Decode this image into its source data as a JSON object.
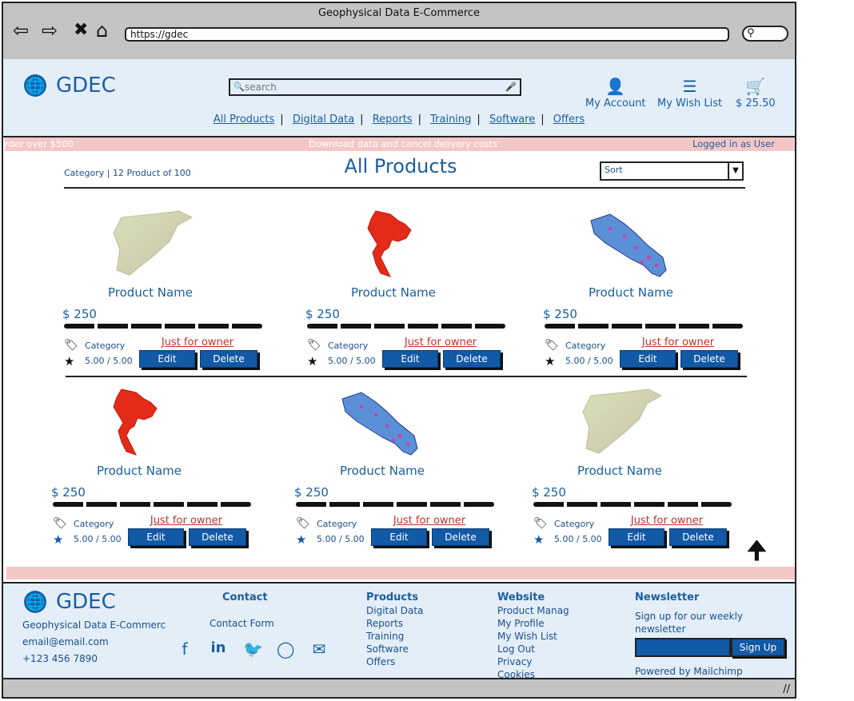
{
  "window": {
    "title": "Geophysical Data E-Commerce",
    "url": "https://gdec"
  },
  "header": {
    "logo": "GDEC",
    "search_placeholder": "search",
    "account": "My Account",
    "wishlist": "My Wish List",
    "cart_total": "$ 25.50",
    "menu": [
      "All Products",
      "Digital Data",
      "Reports",
      "Training",
      "Software",
      "Offers"
    ]
  },
  "promo": {
    "left": "rder over $500",
    "center": "Download data and cancel delivery costs",
    "login": "Logged in as User"
  },
  "listing": {
    "breadcrumb": "Category | 12 Product of 100",
    "title": "All Products",
    "sort": "Sort"
  },
  "products": [
    {
      "name": "Product Name",
      "price": "$ 250",
      "category": "Category",
      "rating": "5.00 / 5.00",
      "owner": "Just for owner",
      "edit": "Edit",
      "delete": "Delete",
      "map": "syria"
    },
    {
      "name": "Product Name",
      "price": "$ 250",
      "category": "Category",
      "rating": "5.00 / 5.00",
      "owner": "Just for owner",
      "edit": "Edit",
      "delete": "Delete",
      "map": "thailand"
    },
    {
      "name": "Product Name",
      "price": "$ 250",
      "category": "Category",
      "rating": "5.00 / 5.00",
      "owner": "Just for owner",
      "edit": "Edit",
      "delete": "Delete",
      "map": "costarica"
    },
    {
      "name": "Product Name",
      "price": "$ 250",
      "category": "Category",
      "rating": "5.00 / 5.00",
      "owner": "Just for owner",
      "edit": "Edit",
      "delete": "Delete",
      "map": "thailand"
    },
    {
      "name": "Product Name",
      "price": "$ 250",
      "category": "Category",
      "rating": "5.00 / 5.00",
      "owner": "Just for owner",
      "edit": "Edit",
      "delete": "Delete",
      "map": "costarica"
    },
    {
      "name": "Product Name",
      "price": "$ 250",
      "category": "Category",
      "rating": "5.00 / 5.00",
      "owner": "Just for owner",
      "edit": "Edit",
      "delete": "Delete",
      "map": "syria"
    }
  ],
  "footer": {
    "logo": "GDEC",
    "company": "Geophysical Data E-Commerc",
    "email": "email@email.com",
    "phone": "+123 456 7890",
    "contact": {
      "heading": "Contact",
      "form": "Contact Form"
    },
    "products": {
      "heading": "Products",
      "items": [
        "Digital Data",
        "Reports",
        "Training",
        "Software",
        "Offers"
      ]
    },
    "website": {
      "heading": "Website",
      "items": [
        "Product Manag",
        "My Profile",
        "My Wish List",
        "Log Out",
        "Privacy",
        "Cookies"
      ]
    },
    "newsletter": {
      "heading": "Newsletter",
      "text1": "Sign up for our weekly",
      "text2": "newsletter",
      "button": "Sign Up",
      "powered": "Powered by Mailchimp"
    }
  },
  "colors": {
    "accent": "#1259a6",
    "header_bg": "#e3eef9",
    "promo_bg": "#f4c7c7",
    "owner_red": "#c0322b"
  }
}
